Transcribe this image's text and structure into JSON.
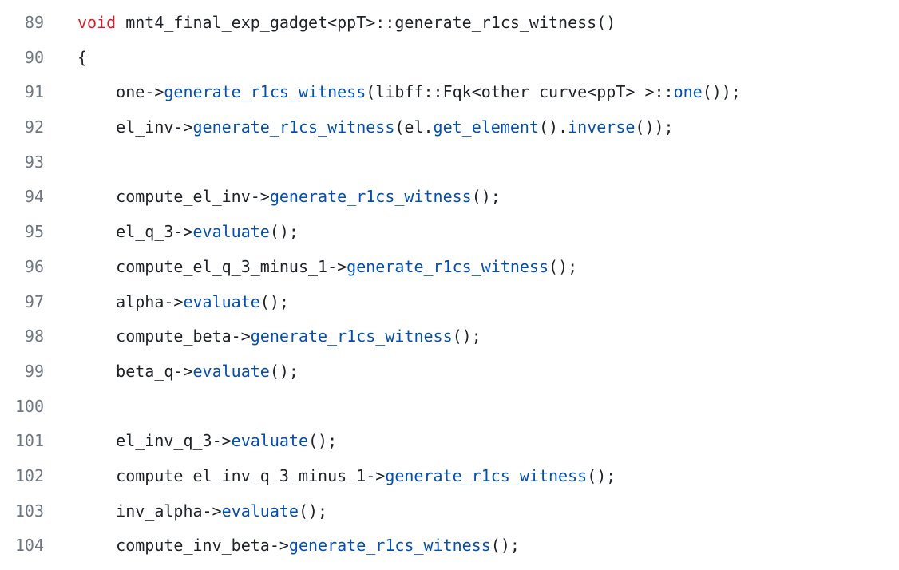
{
  "colors": {
    "background": "#ffffff",
    "line_number": "#6e7781",
    "plain_text": "#1f2328",
    "keyword": "#cf222e",
    "function_call": "#0550ae"
  },
  "lines": [
    {
      "number": "89",
      "tokens": [
        {
          "t": "void",
          "k": "keyword"
        },
        {
          "t": " mnt4_final_exp_gadget<ppT>::generate_r1cs_witness()",
          "k": "plain"
        }
      ]
    },
    {
      "number": "90",
      "tokens": [
        {
          "t": "{",
          "k": "plain"
        }
      ]
    },
    {
      "number": "91",
      "tokens": [
        {
          "t": "    one->",
          "k": "plain"
        },
        {
          "t": "generate_r1cs_witness",
          "k": "func"
        },
        {
          "t": "(libff::Fqk<other_curve<ppT> >::",
          "k": "plain"
        },
        {
          "t": "one",
          "k": "func"
        },
        {
          "t": "());",
          "k": "plain"
        }
      ]
    },
    {
      "number": "92",
      "tokens": [
        {
          "t": "    el_inv->",
          "k": "plain"
        },
        {
          "t": "generate_r1cs_witness",
          "k": "func"
        },
        {
          "t": "(el.",
          "k": "plain"
        },
        {
          "t": "get_element",
          "k": "func"
        },
        {
          "t": "().",
          "k": "plain"
        },
        {
          "t": "inverse",
          "k": "func"
        },
        {
          "t": "());",
          "k": "plain"
        }
      ]
    },
    {
      "number": "93",
      "tokens": []
    },
    {
      "number": "94",
      "tokens": [
        {
          "t": "    compute_el_inv->",
          "k": "plain"
        },
        {
          "t": "generate_r1cs_witness",
          "k": "func"
        },
        {
          "t": "();",
          "k": "plain"
        }
      ]
    },
    {
      "number": "95",
      "tokens": [
        {
          "t": "    el_q_3->",
          "k": "plain"
        },
        {
          "t": "evaluate",
          "k": "func"
        },
        {
          "t": "();",
          "k": "plain"
        }
      ]
    },
    {
      "number": "96",
      "tokens": [
        {
          "t": "    compute_el_q_3_minus_1->",
          "k": "plain"
        },
        {
          "t": "generate_r1cs_witness",
          "k": "func"
        },
        {
          "t": "();",
          "k": "plain"
        }
      ]
    },
    {
      "number": "97",
      "tokens": [
        {
          "t": "    alpha->",
          "k": "plain"
        },
        {
          "t": "evaluate",
          "k": "func"
        },
        {
          "t": "();",
          "k": "plain"
        }
      ]
    },
    {
      "number": "98",
      "tokens": [
        {
          "t": "    compute_beta->",
          "k": "plain"
        },
        {
          "t": "generate_r1cs_witness",
          "k": "func"
        },
        {
          "t": "();",
          "k": "plain"
        }
      ]
    },
    {
      "number": "99",
      "tokens": [
        {
          "t": "    beta_q->",
          "k": "plain"
        },
        {
          "t": "evaluate",
          "k": "func"
        },
        {
          "t": "();",
          "k": "plain"
        }
      ]
    },
    {
      "number": "100",
      "tokens": []
    },
    {
      "number": "101",
      "tokens": [
        {
          "t": "    el_inv_q_3->",
          "k": "plain"
        },
        {
          "t": "evaluate",
          "k": "func"
        },
        {
          "t": "();",
          "k": "plain"
        }
      ]
    },
    {
      "number": "102",
      "tokens": [
        {
          "t": "    compute_el_inv_q_3_minus_1->",
          "k": "plain"
        },
        {
          "t": "generate_r1cs_witness",
          "k": "func"
        },
        {
          "t": "();",
          "k": "plain"
        }
      ]
    },
    {
      "number": "103",
      "tokens": [
        {
          "t": "    inv_alpha->",
          "k": "plain"
        },
        {
          "t": "evaluate",
          "k": "func"
        },
        {
          "t": "();",
          "k": "plain"
        }
      ]
    },
    {
      "number": "104",
      "tokens": [
        {
          "t": "    compute_inv_beta->",
          "k": "plain"
        },
        {
          "t": "generate_r1cs_witness",
          "k": "func"
        },
        {
          "t": "();",
          "k": "plain"
        }
      ]
    }
  ]
}
